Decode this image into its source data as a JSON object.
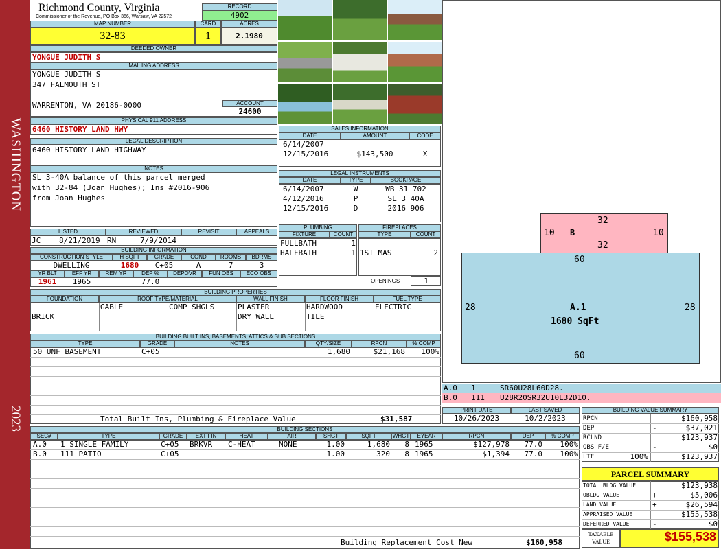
{
  "sidebar": {
    "top": "WASHINGTON",
    "bottom": "2023"
  },
  "header": {
    "county": "Richmond County, Virginia",
    "commissioner": "Commissioner of the Revenue, PO Box 366, Warsaw, VA 22572",
    "record_label": "RECORD",
    "record": "4902",
    "map_label": "MAP NUMBER",
    "map": "32-83",
    "card_label": "CARD",
    "card": "1",
    "acres_label": "ACRES",
    "acres": "2.1980"
  },
  "owner": {
    "deeded_label": "DEEDED OWNER",
    "deeded": "YONGUE JUDITH S",
    "mailing_label": "MAILING ADDRESS",
    "mail1": "YONGUE JUDITH S",
    "mail2": "347 FALMOUTH ST",
    "mail3": "WARRENTON, VA 20186-0000",
    "account_label": "ACCOUNT",
    "account": "24600",
    "physical_label": "PHYSICAL 911 ADDRESS",
    "physical": "6460 HISTORY LAND HWY",
    "legal_label": "LEGAL DESCRIPTION",
    "legal": "6460 HISTORY LAND HIGHWAY",
    "notes_label": "NOTES",
    "notes": [
      "SL 3-40A balance of this parcel merged",
      "with 32-84 (Joan Hughes); Ins #2016-906",
      "from Joan Hughes"
    ]
  },
  "review": {
    "listed_label": "LISTED",
    "reviewed_label": "REVIEWED",
    "revisit_label": "REVISIT",
    "appeals_label": "APPEALS",
    "listed_by": "JC",
    "listed": "8/21/2019",
    "reviewed_by": "RN",
    "reviewed": "7/9/2014"
  },
  "building_info": {
    "label": "BUILDING INFORMATION",
    "h": [
      "CONSTRUCTION STYLE",
      "H SQFT",
      "GRADE",
      "COND",
      "ROOMS",
      "BDRMS"
    ],
    "v": [
      "DWELLING",
      "1680",
      "C+05",
      "A",
      "7",
      "3"
    ],
    "h2": [
      "YR BLT",
      "EFF YR",
      "REM YR",
      "DEP %",
      "DEPOVR",
      "FUN OBS",
      "ECO OBS"
    ],
    "v2": [
      "1961",
      "1965",
      "",
      "77.0",
      "",
      "",
      ""
    ]
  },
  "properties": {
    "label": "BUILDING PROPERTIES",
    "h": [
      "FOUNDATION",
      "ROOF TYPE/MATERIAL",
      "WALL FINISH",
      "FLOOR FINISH",
      "FUEL TYPE"
    ],
    "foundation": "BRICK",
    "roof1": "GABLE",
    "roof2": "COMP SHGLS",
    "wall": [
      "PLASTER",
      "DRY WALL"
    ],
    "floor": [
      "HARDWOOD",
      "TILE"
    ],
    "fuel": "ELECTRIC"
  },
  "builtins": {
    "label": "BUILDING BUILT INS, BASEMENTS, ATTICS & SUB SECTIONS",
    "h": [
      "TYPE",
      "GRADE",
      "NOTES",
      "QTY/SIZE",
      "RPCN",
      "% COMP"
    ],
    "rows": [
      {
        "type": "50 UNF BASEMENT",
        "grade": "C+05",
        "notes": "",
        "qty": "1,680",
        "rpcn": "$21,168",
        "comp": "100%"
      }
    ],
    "total_label": "Total Built Ins, Plumbing & Fireplace Value",
    "total": "$31,587"
  },
  "sales": {
    "label": "SALES INFORMATION",
    "h": [
      "DATE",
      "AMOUNT",
      "CODE"
    ],
    "rows": [
      {
        "date": "6/14/2007",
        "amount": "",
        "code": ""
      },
      {
        "date": "12/15/2016",
        "amount": "$143,500",
        "code": "X"
      }
    ]
  },
  "instruments": {
    "label": "LEGAL INSTRUMENTS",
    "h": [
      "DATE",
      "TYPE",
      "BOOKPAGE"
    ],
    "rows": [
      {
        "date": "6/14/2007",
        "type": "W",
        "bp": "WB 31 702"
      },
      {
        "date": "4/12/2016",
        "type": "P",
        "bp": "SL 3 40A"
      },
      {
        "date": "12/15/2016",
        "type": "D",
        "bp": "2016 906"
      }
    ]
  },
  "plumbing": {
    "label": "PLUMBING",
    "h": [
      "FIXTURE",
      "COUNT"
    ],
    "rows": [
      {
        "f": "FULLBATH",
        "c": "1"
      },
      {
        "f": "HALFBATH",
        "c": "1"
      }
    ]
  },
  "fireplaces": {
    "label": "FIREPLACES",
    "h": [
      "TYPE",
      "COUNT"
    ],
    "rows": [
      {
        "t": "1ST MAS",
        "c": "2"
      }
    ],
    "openings_label": "OPENINGS",
    "openings": "1"
  },
  "sketch": {
    "b_label": "B",
    "b_top": "32",
    "b_bottom": "32",
    "b_left": "10",
    "b_right": "10",
    "a_top": "60",
    "a_bottom": "60",
    "a_left": "28",
    "a_right": "28",
    "a_label": "A.1",
    "a_area": "1680 SqFt",
    "colors": {
      "a": "#add8e6",
      "b": "#ffb6c1"
    }
  },
  "legend": [
    {
      "id": "A.0",
      "code": "1",
      "desc": "SR60U28L60D28."
    },
    {
      "id": "B.0",
      "code": "111",
      "desc": "U28R20SR32U10L32D10."
    }
  ],
  "dates": {
    "print_label": "PRINT DATE",
    "last_label": "LAST SAVED",
    "print": "10/26/2023",
    "last": "10/2/2023"
  },
  "sections": {
    "label": "BUILDING SECTIONS",
    "h": [
      "SEC#",
      "TYPE",
      "GRADE",
      "EXT FIN",
      "HEAT",
      "AIR",
      "SHGT",
      "SQFT",
      "WHGT",
      "EYEAR",
      "RPCN",
      "DEP",
      "% COMP"
    ],
    "rows": [
      {
        "sec": "A.0",
        "type": "1 SINGLE FAMILY",
        "grade": "C+05",
        "ext": "BRKVR",
        "heat": "C-HEAT",
        "air": "NONE",
        "shgt": "1.00",
        "sqft": "1,680",
        "whgt": "8",
        "eyear": "1965",
        "rpcn": "$127,978",
        "dep": "77.0",
        "comp": "100%"
      },
      {
        "sec": "B.0",
        "type": "111 PATIO",
        "grade": "C+05",
        "ext": "",
        "heat": "",
        "air": "",
        "shgt": "1.00",
        "sqft": "320",
        "whgt": "8",
        "eyear": "1965",
        "rpcn": "$1,394",
        "dep": "77.0",
        "comp": "100%"
      }
    ],
    "replacement_label": "Building Replacement Cost New",
    "replacement": "$160,958"
  },
  "bvs": {
    "label": "BUILDING VALUE SUMMARY",
    "rows": [
      {
        "k": "RPCN",
        "s": "",
        "v": "$160,958"
      },
      {
        "k": "DEP",
        "s": "-",
        "v": "$37,021"
      },
      {
        "k": "RCLND",
        "s": "",
        "v": "$123,937"
      },
      {
        "k": "OBS F/E",
        "s": "-",
        "v": "$0"
      },
      {
        "k": "LTF",
        "s": "100%",
        "v": "$123,937"
      }
    ]
  },
  "parcel": {
    "label": "PARCEL SUMMARY",
    "rows": [
      {
        "k": "TOTAL BLDG VALUE",
        "s": "",
        "v": "$123,938"
      },
      {
        "k": "OBLDG VALUE",
        "s": "+",
        "v": "$5,006"
      },
      {
        "k": "LAND VALUE",
        "s": "+",
        "v": "$26,594"
      },
      {
        "k": "APPRAISED VALUE",
        "s": "",
        "v": "$155,538"
      },
      {
        "k": "DEFERRED VALUE",
        "s": "-",
        "v": "$0"
      }
    ],
    "taxable_label1": "TAXABLE",
    "taxable_label2": "VALUE",
    "taxable": "$155,538"
  }
}
